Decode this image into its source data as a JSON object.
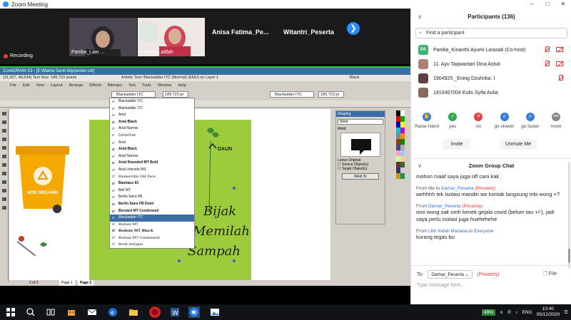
{
  "window": {
    "title": "Zoom Meeting",
    "controls": [
      "–",
      "□",
      "✕"
    ]
  },
  "video_strip": {
    "tiles": [
      {
        "name": "Panitia_Lian ..."
      },
      {
        "name": "Ardianti Latifah"
      }
    ],
    "name_tiles": [
      "Anisa Fatima_Pe...",
      "Witantri_Peserta"
    ],
    "next_icon": "chevron-right",
    "recording_label": "Recording"
  },
  "coreldraw": {
    "title": "CorelDRAW X3 - [E:\\Mama Santi tidy\\poster.cdr]",
    "info_line": "(31,927, 46,634)  Text Size: 189,723 points",
    "center_text": "Artistic Text: Blackadder ITC (Normal) (ENU) on Layer 1",
    "menu": [
      "File",
      "Edit",
      "View",
      "Layout",
      "Arrange",
      "Effects",
      "Bitmaps",
      "Text",
      "Tools",
      "Window",
      "Help"
    ],
    "font_field": "Blackadder ITC",
    "size_field": "189.723 pt",
    "font_field_right": "Blackadder ITC",
    "size_field_right": "189.723 pt",
    "color_label": "Black",
    "fonts": [
      "Blackadder ITC",
      "Blackadder ITC",
      "Arial",
      "Arial Black",
      "Arial Narrow",
      "Consolas",
      "Arial",
      "Arial Black",
      "Arial Narrow",
      "Arial Rounded MT Bold",
      "Arial Unicode MS",
      "Baskerville Old Face",
      "Bauhaus 93",
      "Bell MT",
      "Berlin Sans FB",
      "Berlin Sans FB Demi",
      "Bernard MT Condensed",
      "Blackadder ITC",
      "Bodoni MT",
      "Bodoni MT Black",
      "Bodoni MT Condensed",
      "Book Antiqua"
    ],
    "selected_font_index": 17,
    "shaping": {
      "title": "Shaping",
      "mode": "Weld",
      "sub": "Weld:",
      "leave_label": "Leave Original:",
      "opt1": "Source Object(s)",
      "opt2": "Target Object(s)",
      "button": "Weld To"
    },
    "page_tabs": [
      "2 of 2",
      "Page 1",
      "Page 2"
    ],
    "poster": {
      "bin_label": "NON ORGANIK",
      "daun_label": "DAUN",
      "script_lines": [
        "Bijak",
        "Memilah",
        "Sampah"
      ]
    }
  },
  "participants": {
    "title": "Participants (136)",
    "search_placeholder": "Find a participant",
    "list": [
      {
        "initials": "PA",
        "name": "Panitia_Kinanthi Ayumi Larasati (Co-host)",
        "avatar_color": "#3cb371"
      },
      {
        "initials": "",
        "name": "11. Ayu Taqwantari Dina Astuti",
        "avatar_color": "#b08070"
      },
      {
        "initials": "",
        "name": "1904925 _Ening Dzuhrika. I",
        "avatar_color": "#604040"
      },
      {
        "initials": "",
        "name": "1910407004 Eulis Syifa Aulia",
        "avatar_color": "#8a6a5a"
      }
    ],
    "reactions": [
      {
        "label": "Raise Hand",
        "color": "#3a7be0",
        "glyph": "✋"
      },
      {
        "label": "yes",
        "color": "#2fa84f",
        "glyph": "✓"
      },
      {
        "label": "no",
        "color": "#e4413c",
        "glyph": "✕"
      },
      {
        "label": "go slower",
        "color": "#3a7be0",
        "glyph": "«"
      },
      {
        "label": "go faster",
        "color": "#3a7be0",
        "glyph": "»"
      },
      {
        "label": "more",
        "color": "#888888",
        "glyph": "•••"
      }
    ],
    "invite_label": "Invite",
    "unmute_label": "Unmute Me"
  },
  "chat": {
    "title": "Zoom Group Chat",
    "messages": [
      {
        "from": "",
        "who": "",
        "priv": "",
        "text": "mohon maaf saya juga off cam kak"
      },
      {
        "from": "From Me to ",
        "who": "Damar_Peserta",
        "priv": "(Privately)",
        "text": "wehhhh tek isolasi mandiri we kontak langsung mbi wong +?"
      },
      {
        "from": "From ",
        "who": "Damar_Peserta",
        "priv": "(Privately)",
        "text": "ono wong sak omh kenek gejala covid (belum tau +/-), jadi saya perlu isolasi juga huehehehe"
      },
      {
        "from": "From ",
        "who": "Lilin Indah Mariana",
        "to": "to ",
        "to_who": "Everyone",
        "text": "kurang tegas bu"
      }
    ],
    "to_label": "To:",
    "to_value": "Damar_Peserta",
    "to_private": "(Privately)",
    "file_label": "File",
    "input_placeholder": "Type message here..."
  },
  "taskbar": {
    "battery": "49%",
    "lang": "ENG",
    "time": "10:40",
    "date": "05/12/2020"
  }
}
